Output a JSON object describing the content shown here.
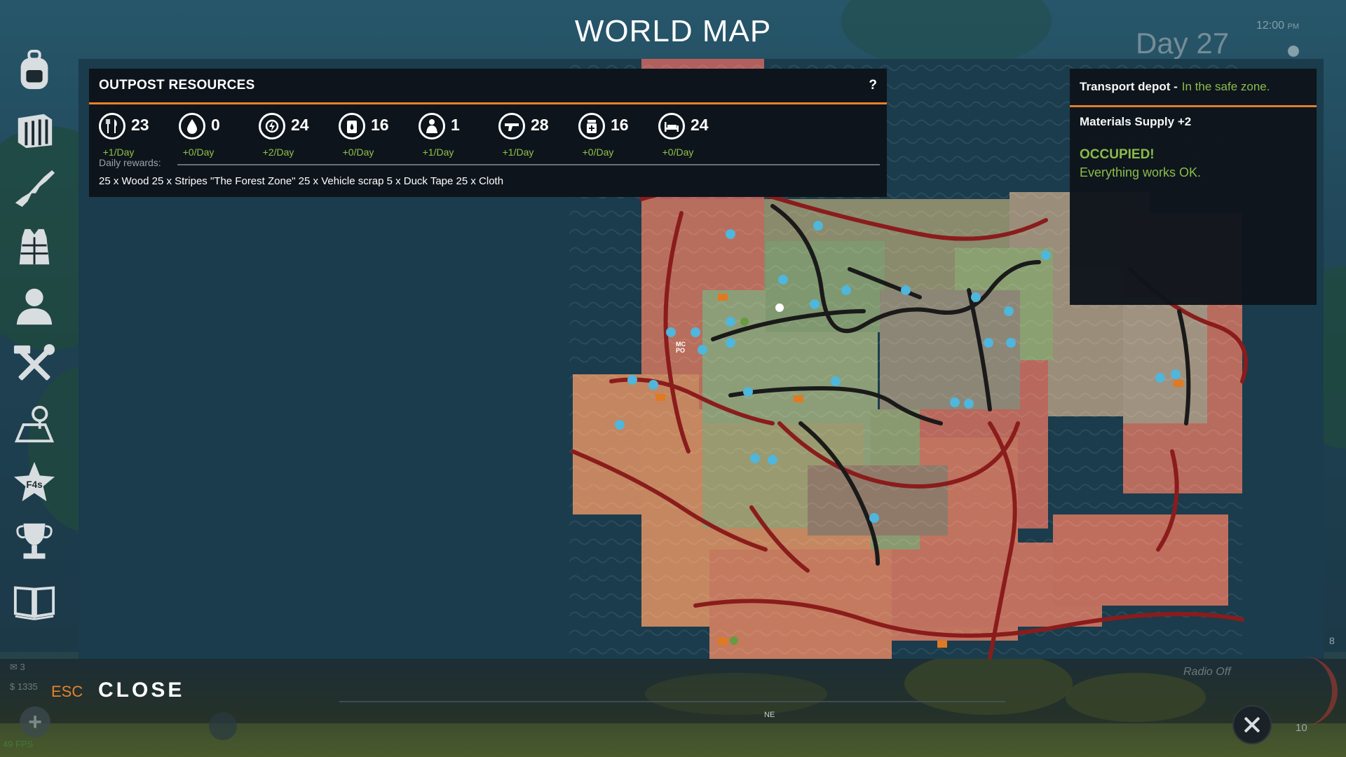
{
  "header": {
    "title": "WORLD MAP",
    "day": "Day 27",
    "time": "12:00",
    "time_suffix": "PM"
  },
  "sidebar": {
    "items": [
      {
        "name": "backpack-icon"
      },
      {
        "name": "crate-icon"
      },
      {
        "name": "rifle-icon"
      },
      {
        "name": "vest-icon"
      },
      {
        "name": "character-icon"
      },
      {
        "name": "crafting-tools-icon"
      },
      {
        "name": "map-pin-icon"
      },
      {
        "name": "f4s-star-icon"
      },
      {
        "name": "trophy-icon"
      },
      {
        "name": "journal-book-icon"
      }
    ]
  },
  "resources": {
    "title": "OUTPOST RESOURCES",
    "help": "?",
    "items": [
      {
        "icon": "food-icon",
        "value": "23",
        "rate": "+1/Day"
      },
      {
        "icon": "water-icon",
        "value": "0",
        "rate": "+0/Day"
      },
      {
        "icon": "energy-icon",
        "value": "24",
        "rate": "+2/Day"
      },
      {
        "icon": "fuel-icon",
        "value": "16",
        "rate": "+0/Day"
      },
      {
        "icon": "survivor-icon",
        "value": "1",
        "rate": "+1/Day"
      },
      {
        "icon": "weapon-icon",
        "value": "28",
        "rate": "+1/Day"
      },
      {
        "icon": "medicine-icon",
        "value": "16",
        "rate": "+0/Day"
      },
      {
        "icon": "bed-icon",
        "value": "24",
        "rate": "+0/Day"
      }
    ],
    "daily_label": "Daily rewards:",
    "daily_text": "25 x Wood 25 x Stripes \"The Forest Zone\" 25 x Vehicle scrap 5 x Duck Tape 25 x Cloth"
  },
  "info": {
    "name": "Transport depot -",
    "zone": "In the safe zone.",
    "supply": "Materials Supply +2",
    "status": "OCCUPIED!",
    "status_detail": "Everything works OK."
  },
  "map": {
    "labels": [
      "MC",
      "PO"
    ],
    "colors": {
      "danger": "#b55c5a",
      "mid": "#c88a5e",
      "safe": "#8fa07a",
      "road": "#8a1c1c",
      "road_dark": "#1a1a1a",
      "marker": "#4fb6dc",
      "outpost": "#e07a20"
    }
  },
  "bottom": {
    "esc": "ESC",
    "close": "CLOSE",
    "mail_count": "3",
    "money": "1335",
    "fps": "49 FPS",
    "compass": "NE",
    "radio": "Radio Off",
    "gauge_top": "8",
    "gauge_bottom": "10"
  },
  "accent": "#e6822a",
  "positive": "#8fc24a"
}
